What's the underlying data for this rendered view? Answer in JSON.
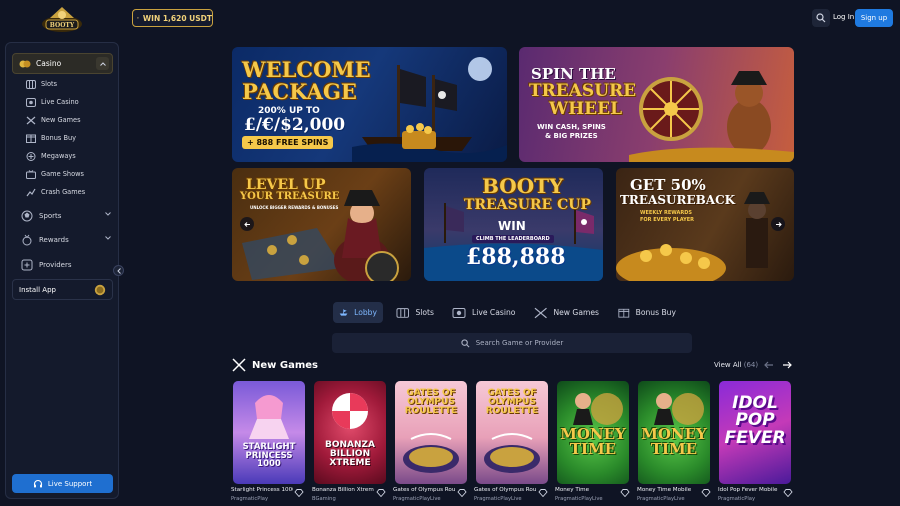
{
  "header": {
    "logo_text": "BOOTY CASINO",
    "win_badge": "WIN 1,620 USDT",
    "login_label": "Log In",
    "signup_label": "Sign up"
  },
  "sidebar": {
    "casino_label": "Casino",
    "casino_items": [
      {
        "label": "Slots",
        "icon": "slot-machine-icon"
      },
      {
        "label": "Live Casino",
        "icon": "live-casino-icon"
      },
      {
        "label": "New Games",
        "icon": "crossed-swords-icon"
      },
      {
        "label": "Bonus Buy",
        "icon": "bonus-buy-icon"
      },
      {
        "label": "Megaways",
        "icon": "megaways-icon"
      },
      {
        "label": "Game Shows",
        "icon": "game-shows-icon"
      },
      {
        "label": "Crash Games",
        "icon": "crash-games-icon"
      }
    ],
    "sports_label": "Sports",
    "rewards_label": "Rewards",
    "providers_label": "Providers",
    "install_label": "Install App",
    "live_support_label": "Live Support"
  },
  "banners": {
    "welcome": {
      "line1": "WELCOME",
      "line2": "PACKAGE",
      "line3": "200% UP TO",
      "line4": "£/€/$2,000",
      "line5": "+ 888 FREE SPINS"
    },
    "wheel": {
      "line1": "SPIN THE",
      "line2": "TREASURE",
      "line3": "WHEEL",
      "line4": "WIN CASH, SPINS",
      "line5": "& BIG PRIZES"
    },
    "levelup": {
      "line1": "LEVEL UP",
      "line2": "YOUR TREASURE",
      "line3": "UNLOCK BIGGER REWARDS & BONUSES"
    },
    "cup": {
      "line1": "BOOTY",
      "line2": "TREASURE CUP",
      "line3": "WIN",
      "line4": "CLIMB THE LEADERBOARD",
      "line5": "£88,888"
    },
    "treasureback": {
      "line1": "GET 50%",
      "line2": "TREASUREBACK",
      "line3": "WEEKLY REWARDS",
      "line4": "FOR EVERY PLAYER"
    }
  },
  "tabs": [
    {
      "label": "Lobby",
      "active": true
    },
    {
      "label": "Slots",
      "active": false
    },
    {
      "label": "Live Casino",
      "active": false
    },
    {
      "label": "New Games",
      "active": false
    },
    {
      "label": "Bonus Buy",
      "active": false
    }
  ],
  "search": {
    "placeholder": "Search Game or Provider"
  },
  "new_games": {
    "title": "New Games",
    "view_all": "View All",
    "count": "(64)",
    "games": [
      {
        "name": "Starlight Princess 1000",
        "provider": "PragmaticPlay",
        "art": "STARLIGHT PRINCESS 1000"
      },
      {
        "name": "Bonanza Billion Xtreme",
        "provider": "BGaming",
        "art": "BONANZA BILLION XTREME"
      },
      {
        "name": "Gates of Olympus Rou...",
        "provider": "PragmaticPlayLive",
        "art": "GATES OF OLYMPUS ROULETTE"
      },
      {
        "name": "Gates of Olympus Rou...",
        "provider": "PragmaticPlayLive",
        "art": "GATES OF OLYMPUS ROULETTE"
      },
      {
        "name": "Money Time",
        "provider": "PragmaticPlayLive",
        "art": "MONEY TIME"
      },
      {
        "name": "Money Time Mobile",
        "provider": "PragmaticPlayLive",
        "art": "MONEY TIME"
      },
      {
        "name": "Idol Pop Fever Mobile",
        "provider": "PragmaticPlay",
        "art": "IDOL POP FEVER"
      }
    ]
  },
  "colors": {
    "accent": "#1f7ae0",
    "gold": "#f5c84a",
    "bg": "#0f1424"
  }
}
